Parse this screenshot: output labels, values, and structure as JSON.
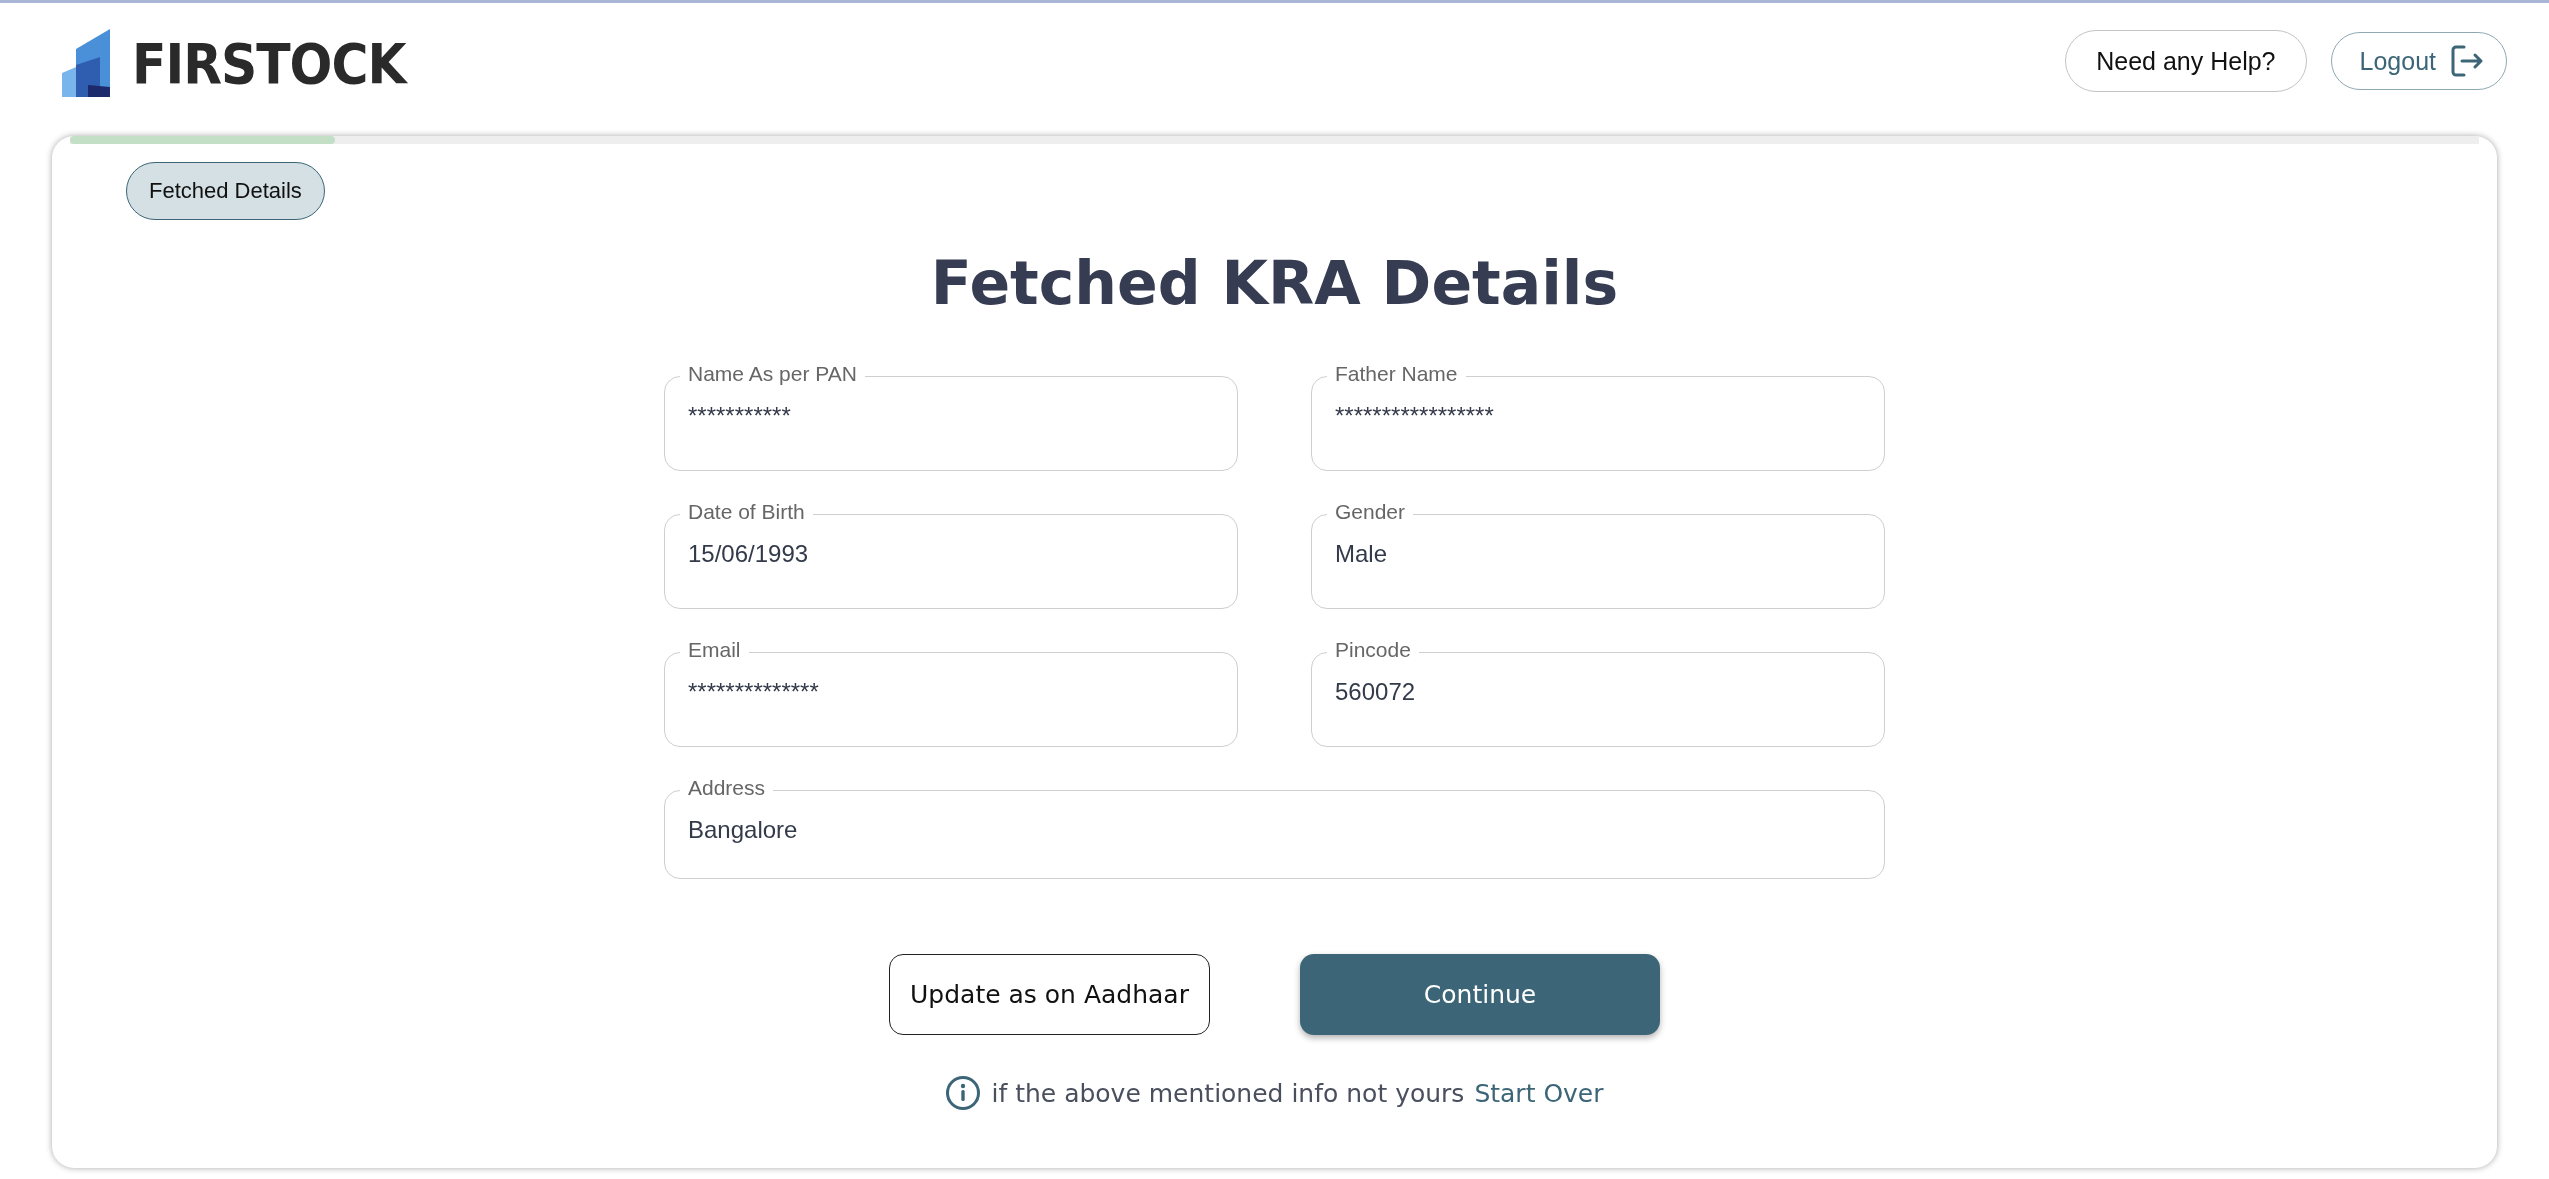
{
  "header": {
    "logo_text": "FIRSTOCK",
    "help_button": "Need any Help?",
    "logout_button": "Logout"
  },
  "progress": {
    "level": 0.11
  },
  "step_chip": "Fetched Details",
  "title": "Fetched KRA Details",
  "fields": [
    {
      "kind": "half",
      "label": "Name As per PAN",
      "value": "***********"
    },
    {
      "kind": "half",
      "label": "Father Name",
      "value": "*****************"
    },
    {
      "kind": "half",
      "label": "Date of Birth",
      "value": "15/06/1993"
    },
    {
      "kind": "half",
      "label": "Gender",
      "value": "Male"
    },
    {
      "kind": "half",
      "label": "Email",
      "value": "**************"
    },
    {
      "kind": "half",
      "label": "Pincode",
      "value": "560072"
    },
    {
      "kind": "full",
      "label": "Address",
      "value": "Bangalore"
    }
  ],
  "buttons": [
    {
      "kind": "outline",
      "label": "Update as on Aadhaar"
    },
    {
      "kind": "primary",
      "label": "Continue"
    }
  ],
  "note": {
    "text": "if the above mentioned info not yours",
    "link": "Start Over"
  }
}
